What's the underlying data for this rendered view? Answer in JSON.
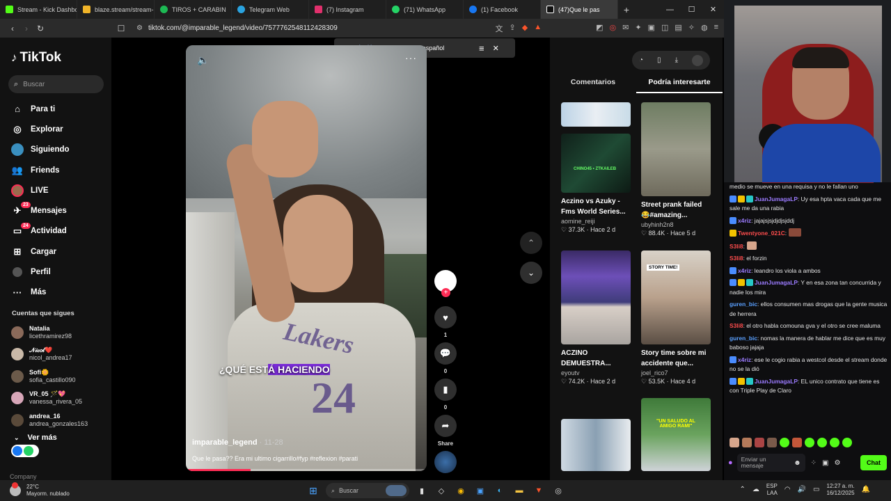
{
  "browser": {
    "tabs": [
      {
        "label": "Stream - Kick Dashbo",
        "color": "#53fc18"
      },
      {
        "label": "blaze.stream/stream-",
        "color": "#f0b429"
      },
      {
        "label": "TIROS + CARABIN",
        "color": "#1db954"
      },
      {
        "label": "Telegram Web",
        "color": "#2aa3e0"
      },
      {
        "label": "(7) Instagram",
        "color": "#e1306c"
      },
      {
        "label": "(71) WhatsApp",
        "color": "#25d366"
      },
      {
        "label": "(1) Facebook",
        "color": "#1877f2"
      },
      {
        "label": "(47)Que le pas",
        "color": "#ffffff"
      }
    ],
    "url": "tiktok.com/@imparable_legend/video/7577762548112428309",
    "translate": {
      "lang_a": "Inglés",
      "lang_b": "español"
    }
  },
  "tiktok": {
    "logo": "TikTok",
    "search_placeholder": "Buscar",
    "nav": [
      {
        "label": "Para ti",
        "icon": "home-icon"
      },
      {
        "label": "Explorar",
        "icon": "compass-icon"
      },
      {
        "label": "Siguiendo",
        "icon": "following-icon"
      },
      {
        "label": "Friends",
        "icon": "friends-icon"
      },
      {
        "label": "LIVE",
        "icon": "live-icon"
      },
      {
        "label": "Mensajes",
        "icon": "messages-icon",
        "badge": "23"
      },
      {
        "label": "Actividad",
        "icon": "activity-icon",
        "badge": "24"
      },
      {
        "label": "Cargar",
        "icon": "upload-icon"
      },
      {
        "label": "Perfil",
        "icon": "profile-icon"
      },
      {
        "label": "Más",
        "icon": "more-icon"
      }
    ],
    "following_title": "Cuentas que sigues",
    "following": [
      {
        "name": "Natalia",
        "handle": "licethramirez98",
        "color": "#8a6a5a"
      },
      {
        "name": "𝒩𝒾𝒸𝑜𝓁❤️",
        "handle": "nicol_andrea17",
        "color": "#c9b9a8"
      },
      {
        "name": "Sofi🌼",
        "handle": "sofia_castillo090",
        "color": "#6b5a4a"
      },
      {
        "name": "VR_05 🪄💖",
        "handle": "vanessa_rivera_05",
        "color": "#d7a6b8"
      },
      {
        "name": "andrea_16",
        "handle": "andrea_gonzales163",
        "color": "#5a4a3a"
      }
    ],
    "see_more": "Ver más",
    "company": "Company"
  },
  "video": {
    "overlay_text_a": "¿QUÉ EST",
    "overlay_text_hl": "Á HACIENDO",
    "username": "imparable_legend",
    "date": " · 11-28",
    "description": "Que le pasa?? Era mi ultimo cigarrillo#fyp #reflexion #parati",
    "progress": 0.27,
    "likes": "1",
    "comments": "0",
    "saves": "0",
    "share_label": "Share"
  },
  "right_panel": {
    "tab_comments": "Comentarios",
    "tab_related": "Podría interesarte",
    "cards": [
      {
        "title": "Aczino vs Azuky - Fms World Series...",
        "author": "aomine_reiji",
        "likes": "37.3K",
        "age": "Hace 2 d"
      },
      {
        "title": "Street prank failed 😂#amazing...",
        "author": "ubyhinh2n8",
        "likes": "88.4K",
        "age": "Hace 5 d"
      },
      {
        "title": "ACZINO DEMUESTRA...",
        "author": "eyoutv",
        "likes": "74.2K",
        "age": "Hace 2 d"
      },
      {
        "title": "Story time sobre mi accidente que...",
        "author": "joel_rico7",
        "likes": "53.5K",
        "age": "Hace 4 d"
      }
    ],
    "thumb_labels": {
      "card2": "CHINO45 • ZTKAILEB",
      "card4": "STORY TIME!",
      "card6": "\"UN SALUDO AL AMIGO RAMI\""
    }
  },
  "stream": {
    "chat": [
      {
        "user": "",
        "text": "medio se mueve en una requisa y no le fallan uno",
        "color": "#ffffff"
      },
      {
        "user": "JuanJumagaLP",
        "text": ": Uy esa hpta vaca cada que me sale me da una rabia",
        "color": "#9b7bff"
      },
      {
        "user": "x4riz",
        "text": ": jajajsjsjdjdjsjddj",
        "color": "#9b7bff"
      },
      {
        "user": "Twentyone_021C",
        "text": ":",
        "color": "#ff4d4d"
      },
      {
        "user": "S3li8",
        "text": ":",
        "color": "#ff4d4d"
      },
      {
        "user": "S3li8",
        "text": ": el forzin",
        "color": "#ff4d4d"
      },
      {
        "user": "x4riz",
        "text": ": leandro los viola a ambos",
        "color": "#9b7bff"
      },
      {
        "user": "JuanJumagaLP",
        "text": ": Y en esa zona tan concurrida y nadie los mira",
        "color": "#9b7bff"
      },
      {
        "user": "guren_bic",
        "text": ": ellos consumen mas drogas que la gente musica de herrera",
        "color": "#5aa0ff"
      },
      {
        "user": "S3li8",
        "text": ": el otro habla comouna gva y el otro se cree maluma",
        "color": "#ff4d4d"
      },
      {
        "user": "guren_bic",
        "text": ": nomas la manera de hablar me dice que es muy baboso jajaja",
        "color": "#5aa0ff"
      },
      {
        "user": "x4riz",
        "text": ": ese le cogio rabia a westcol desde el stream donde no se la dió",
        "color": "#9b7bff"
      },
      {
        "user": "JuanJumagaLP",
        "text": ": EL unico contrato que tiene es con Triple Play de Claro",
        "color": "#9b7bff"
      }
    ],
    "input_placeholder": "Enviar un mensaje",
    "chat_button": "Chat"
  },
  "taskbar": {
    "temp": "22°C",
    "weather": "Mayorm. nublado",
    "search": "Buscar",
    "lang_a": "ESP",
    "lang_b": "LAA",
    "time": "12:27 a. m.",
    "date": "16/12/2025"
  }
}
